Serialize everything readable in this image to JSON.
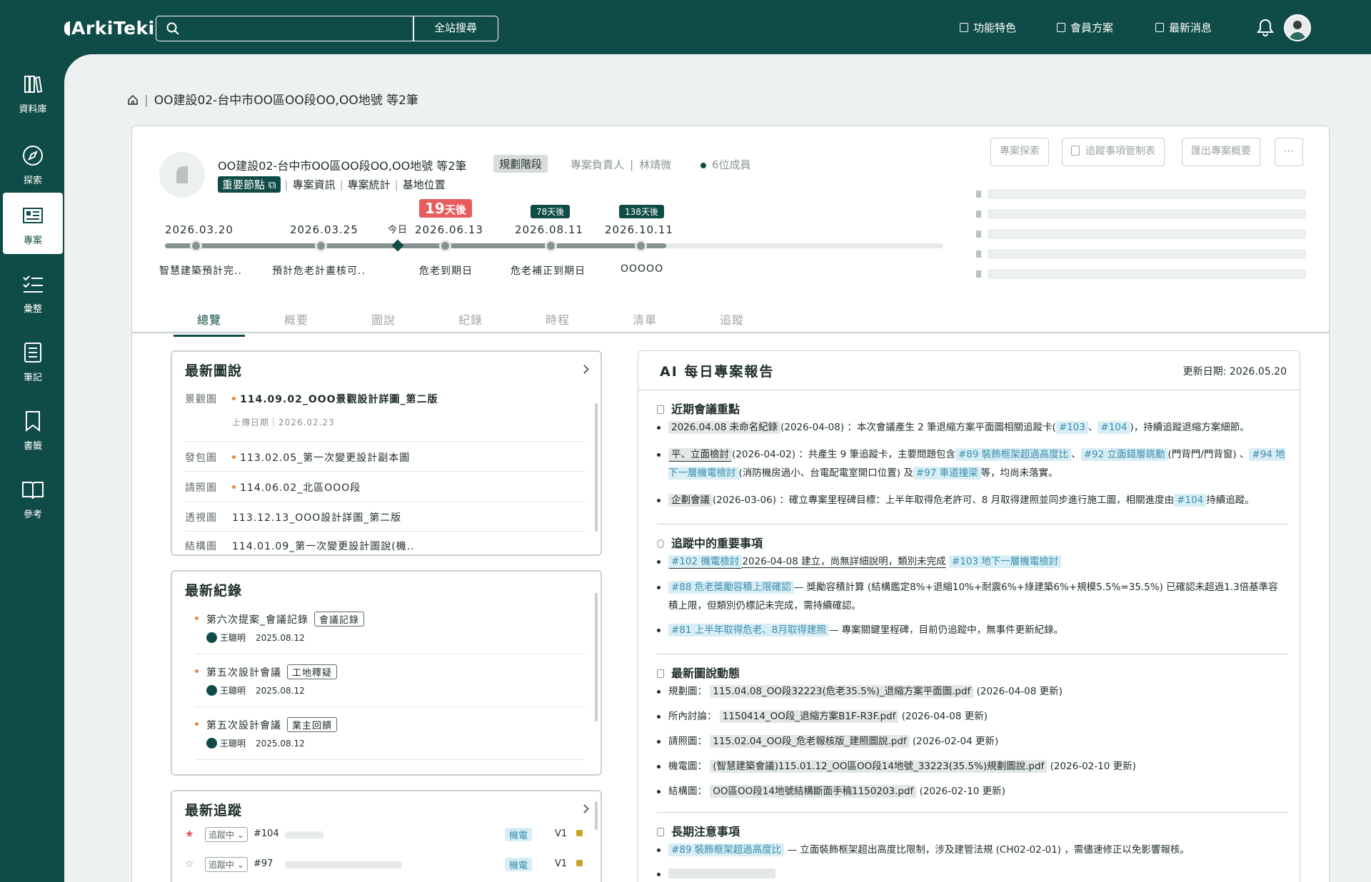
{
  "app": {
    "logo": "ArkiTeki",
    "search": {
      "placeholder": "",
      "button": "全站搜尋"
    },
    "topnav": [
      "功能特色",
      "會員方案",
      "最新消息"
    ]
  },
  "sidebar": [
    {
      "label": "資料庫",
      "icon": "library-icon"
    },
    {
      "label": "探索",
      "icon": "compass-icon"
    },
    {
      "label": "專案",
      "icon": "project-icon",
      "active": true
    },
    {
      "label": "彙整",
      "icon": "checklist-icon"
    },
    {
      "label": "筆記",
      "icon": "note-icon"
    },
    {
      "label": "書籤",
      "icon": "bookmark-icon"
    },
    {
      "label": "參考",
      "icon": "book-icon"
    }
  ],
  "breadcrumb": {
    "current": "OO建設02-台中市OO區OO段OO,OO地號 等2筆"
  },
  "project": {
    "title": "OO建設02-台中市OO區OO段OO,OO地號 等2筆",
    "stage": "規劃階段",
    "owner_label": "專案負責人",
    "owner": "林靖微",
    "members": "6位成員",
    "subnav": [
      "重要節點",
      "專案資訊",
      "專案統計",
      "基地位置"
    ],
    "actions": [
      "專案探索",
      "追蹤事項管制表",
      "匯出專案概要",
      "⋯"
    ]
  },
  "timeline": {
    "today_label": "今日",
    "milestones": [
      {
        "date": "2026.03.20",
        "label": "智慧建築預計完..",
        "badge": ""
      },
      {
        "date": "2026.03.25",
        "label": "預計危老計畫核可..",
        "badge": ""
      },
      {
        "date": "2026.06.13",
        "label": "危老到期日",
        "badge_num": "19",
        "badge_unit": "天後"
      },
      {
        "date": "2026.08.11",
        "label": "危老補正到期日",
        "badge": "78天後"
      },
      {
        "date": "2026.10.11",
        "label": "OOOOO",
        "badge": "138天後"
      }
    ]
  },
  "tabs": [
    "總覽",
    "概要",
    "圖說",
    "紀錄",
    "時程",
    "清單",
    "追蹤"
  ],
  "drawings": {
    "title": "最新圖說",
    "items": [
      {
        "cat": "景觀圖",
        "name": "114.09.02_OOO景觀設計詳圖_第二版",
        "meta": "上傳日期｜2026.02.23"
      },
      {
        "cat": "發包圖",
        "name": "113.02.05_第一次變更設計副本圖"
      },
      {
        "cat": "請照圖",
        "name": "114.06.02_北區OOO段"
      },
      {
        "cat": "透視圖",
        "name": "113.12.13_OOO設計詳圖_第二版"
      },
      {
        "cat": "結構圖",
        "name": "114.01.09_第一次變更設計圖說(機.."
      }
    ]
  },
  "records": {
    "title": "最新紀錄",
    "items": [
      {
        "title": "第六次提案_會議記錄",
        "tag": "會議記錄",
        "user": "王聰明",
        "date": "2025.08.12"
      },
      {
        "title": "第五次設計會議",
        "tag": "工地釋疑",
        "user": "王聰明",
        "date": "2025.08.12"
      },
      {
        "title": "第五次設計會議",
        "tag": "業主回饋",
        "user": "王聰明",
        "date": "2025.08.12"
      }
    ]
  },
  "tracking": {
    "title": "最新追蹤",
    "items": [
      {
        "star": "★",
        "status": "追蹤中 ⌄",
        "num": "#104",
        "cat": "機電",
        "ver": "V1"
      },
      {
        "star": "☆",
        "status": "追蹤中 ⌄",
        "num": "#97",
        "cat": "機電",
        "ver": "V1"
      }
    ]
  },
  "ai_report": {
    "title": "AI 每日專案報告",
    "updated_label": "更新日期:",
    "updated": "2026.05.20",
    "sections": [
      {
        "title": "近期會議重點"
      },
      {
        "title": "追蹤中的重要事項"
      },
      {
        "title": "最新圖說動態"
      },
      {
        "title": "長期注意事項"
      }
    ],
    "meetings": {
      "l1": {
        "a": "2026.04.08 未命名紀錄",
        "b": "(2026-04-08) ：本次會議產生 2 筆退縮方案平面圖相關追蹤卡(",
        "c": "#103",
        "d": "、",
        "e": "#104",
        "f": ")，持續追蹤退縮方案細節。"
      },
      "l2": {
        "a": "平、立面檢討",
        "b": "(2026-04-02) ：共產生 9 筆追蹤卡，主要問題包含",
        "c": "#89 裝飾框架超過高度比",
        "d": "、",
        "e": "#92 立面錯層跳動",
        "f": "(門背門/門背窗) 、",
        "g": "#94 地下一層機電檢討",
        "h": "(消防機房過小、台電配電室開口位置) 及",
        "i": "#97 車道撞梁",
        "j": "等，均尚未落實。"
      },
      "l3": {
        "a": "企劃會議",
        "b": "(2026-03-06) ：確立專案里程碑目標：上半年取得危老許可、8 月取得建照並同步進行施工圖，相關進度由",
        "c": "#104",
        "d": "持續追蹤。"
      }
    },
    "tracking_items": {
      "l1": {
        "a": "#102 機電檢討",
        "b": "2026-04-08 建立，尚無詳細說明，類別未完成",
        "c": "#103 地下一層機電檢討"
      },
      "l2": {
        "a": "#88 危老獎勵容積上限確認",
        "b": "— 獎勵容積計算 (結構鑑定8%+退縮10%+耐震6%+綠建築6%+規模5.5%=35.5%) 已確認未超過1.3倍基準容積上限，但類別仍標記未完成，需持續確認。"
      },
      "l3": {
        "a": "#81 上半年取得危老、8月取得建照",
        "b": "— 專案關鍵里程碑，目前仍追蹤中，無事件更新紀錄。"
      }
    },
    "drawings_items": [
      {
        "cat": "規劃圖：",
        "file": "115.04.08_OO段32223(危老35.5%)_退縮方案平面圖.pdf",
        "upd": "(2026-04-08 更新)"
      },
      {
        "cat": "所內討論：",
        "file": "1150414_OO段_退縮方案B1F-R3F.pdf",
        "upd": "(2026-04-08 更新)"
      },
      {
        "cat": "請照圖：",
        "file": "115.02.04_OO段_危老報核版_建照圖說.pdf",
        "upd": "(2026-02-04 更新)"
      },
      {
        "cat": "機電圖：",
        "file": "(智慧建築會議)115.01.12_OO區OO段14地號_33223(35.5%)規劃圖說.pdf",
        "upd": "(2026-02-10 更新)"
      },
      {
        "cat": "結構圖：",
        "file": "OO區OO段14地號結構斷面手稿1150203.pdf",
        "upd": "(2026-02-10 更新)"
      }
    ],
    "longterm": {
      "a": "#89 裝飾框架超過高度比",
      "b": "— 立面裝飾框架超出高度比限制，涉及建管法規 (CH02-02-01) ，需儘速修正以免影響報核。"
    }
  }
}
